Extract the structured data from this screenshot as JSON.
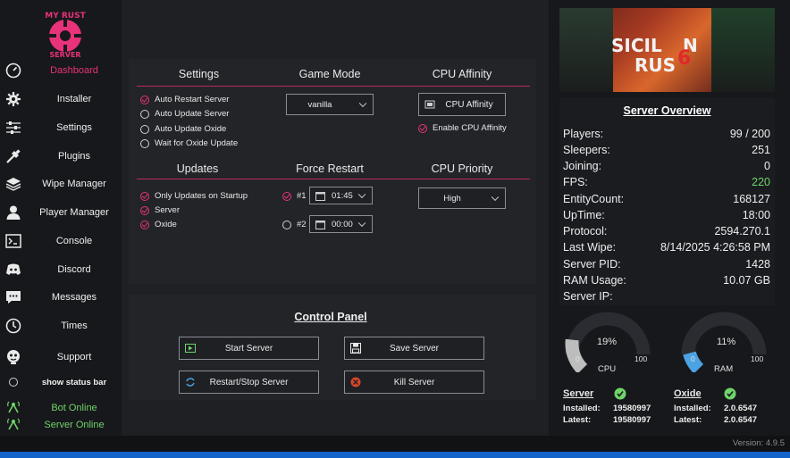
{
  "sidebar": {
    "logo_text": "MY RUST SERVER",
    "items": [
      {
        "label": "Dashboard",
        "icon": "speedometer-icon",
        "active": true
      },
      {
        "label": "Installer",
        "icon": "gear-icon"
      },
      {
        "label": "Settings",
        "icon": "sliders-icon"
      },
      {
        "label": "Plugins",
        "icon": "plug-icon"
      },
      {
        "label": "Wipe Manager",
        "icon": "layers-icon"
      },
      {
        "label": "Player Manager",
        "icon": "user-icon"
      },
      {
        "label": "Console",
        "icon": "terminal-icon"
      },
      {
        "label": "Discord",
        "icon": "discord-icon"
      },
      {
        "label": "Messages",
        "icon": "chat-icon"
      },
      {
        "label": "Times",
        "icon": "clock-icon"
      },
      {
        "label": "Support",
        "icon": "support-icon"
      }
    ],
    "show_status_bar": "show status bar",
    "bot_status": "Bot Online",
    "server_status": "Server Online"
  },
  "settings": {
    "header": "Settings",
    "options": [
      {
        "label": "Auto Restart Server",
        "checked": true
      },
      {
        "label": "Auto Update Server",
        "checked": false
      },
      {
        "label": "Auto Update Oxide",
        "checked": false
      },
      {
        "label": "Wait for Oxide Update",
        "checked": false
      }
    ]
  },
  "game_mode": {
    "header": "Game Mode",
    "value": "vanilla"
  },
  "cpu_affinity": {
    "header": "CPU Affinity",
    "button": "CPU Affinity",
    "enable_label": "Enable CPU Affinity",
    "enabled": true
  },
  "updates": {
    "header": "Updates",
    "options": [
      {
        "label": "Only Updates on Startup",
        "checked": true
      },
      {
        "label": "Server",
        "checked": true
      },
      {
        "label": "Oxide",
        "checked": true
      }
    ]
  },
  "force_restart": {
    "header": "Force Restart",
    "slots": [
      {
        "label": "#1",
        "checked": true,
        "time": "01:45"
      },
      {
        "label": "#2",
        "checked": false,
        "time": "00:00"
      }
    ]
  },
  "cpu_priority": {
    "header": "CPU Priority",
    "value": "High"
  },
  "control_panel": {
    "title": "Control Panel",
    "start": "Start Server",
    "save": "Save Server",
    "restart": "Restart/Stop Server",
    "kill": "Kill Server"
  },
  "banner": {
    "text_a": "SICIL",
    "text_b": "RUS",
    "text_c": "N",
    "accent": "6"
  },
  "overview": {
    "title": "Server Overview",
    "rows": [
      {
        "key": "Players:",
        "value": "99 / 200"
      },
      {
        "key": "Sleepers:",
        "value": "251"
      },
      {
        "key": "Joining:",
        "value": "0"
      },
      {
        "key": "FPS:",
        "value": "220"
      },
      {
        "key": "EntityCount:",
        "value": "168127"
      },
      {
        "key": "UpTime:",
        "value": "18:00"
      },
      {
        "key": "Protocol:",
        "value": "2594.270.1"
      },
      {
        "key": "Last Wipe:",
        "value": "8/14/2025 4:26:58 PM"
      },
      {
        "key": "Server PID:",
        "value": "1428"
      },
      {
        "key": "RAM Usage:",
        "value": "10.07 GB"
      },
      {
        "key": "Server IP:",
        "value": ""
      }
    ],
    "fps_color": "#6fd36a"
  },
  "gauges": [
    {
      "label": "CPU",
      "percent": 19,
      "display": "19%",
      "min": "0",
      "max": "100",
      "color": "#bdbdbd"
    },
    {
      "label": "RAM",
      "percent": 11,
      "display": "11%",
      "min": "0",
      "max": "100",
      "color": "#4ba3e3"
    }
  ],
  "versions": {
    "server": {
      "title": "Server",
      "installed_label": "Installed:",
      "installed": "19580997",
      "latest_label": "Latest:",
      "latest": "19580997"
    },
    "oxide": {
      "title": "Oxide",
      "installed_label": "Installed:",
      "installed": "2.0.6547",
      "latest_label": "Latest:",
      "latest": "2.0.6547"
    }
  },
  "footer": {
    "version": "Version: 4.9.5"
  },
  "colors": {
    "accent": "#e8327a",
    "online": "#6fd36a",
    "panel": "#222428"
  }
}
